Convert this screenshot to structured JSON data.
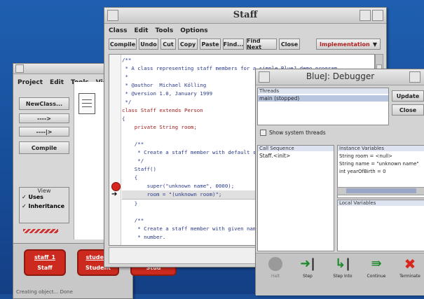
{
  "bluej_main": {
    "menu": [
      "Project",
      "Edit",
      "Tools",
      "View"
    ],
    "buttons": {
      "new_class": "NewClass...",
      "arrow1": "---->",
      "arrow2": "----|>",
      "compile": "Compile"
    },
    "view_panel": {
      "label": "View",
      "uses": "Uses",
      "inheritance": "Inheritance"
    },
    "objects": [
      {
        "line1": "staff_1",
        "line2": "Staff"
      },
      {
        "line1": "student",
        "line2": "Student"
      },
      {
        "line1": "",
        "line2": "Stud"
      }
    ],
    "status": "Creating object... Done"
  },
  "editor": {
    "title": "Staff",
    "menu": [
      "Class",
      "Edit",
      "Tools",
      "Options"
    ],
    "toolbar": [
      "Compile",
      "Undo",
      "Cut",
      "Copy",
      "Paste",
      "Find...",
      "Find Next",
      "Close"
    ],
    "view_select": "Implementation",
    "code": [
      "/**",
      " * A class representing staff members for a simple BlueJ demo program.",
      " *",
      " * @author  Michael Kölling",
      " * @version 1.0, January 1999",
      " */",
      "class Staff extends Person",
      "{",
      "    private String room;",
      "",
      "    /**",
      "     * Create a staff member with default settings.",
      "     */",
      "    Staff()",
      "    {",
      "        super(\"unknown name\", 0000);",
      "        room = \"(unknown room)\";",
      "    }",
      "",
      "    /**",
      "     * Create a staff member with given name, year of birth and room",
      "     * number."
    ],
    "stop_line": 15,
    "exec_line": 16
  },
  "debugger": {
    "title": "BlueJ:  Debugger",
    "threads_label": "Threads",
    "threads": [
      "main (stopped)"
    ],
    "update_button": "Update",
    "close_button": "Close",
    "show_system_threads": "Show system threads",
    "call_sequence_label": "Call Sequence",
    "call_sequence": [
      "Staff.<init>"
    ],
    "instance_variables_label": "Instance Variables",
    "instance_variables": [
      "String room = <null>",
      "String name = \"unknown name\"",
      "int yearOfBirth = 0"
    ],
    "local_variables_label": "Local Variables",
    "controls": [
      "Halt",
      "Step",
      "Step Into",
      "Continue",
      "Terminate"
    ]
  }
}
